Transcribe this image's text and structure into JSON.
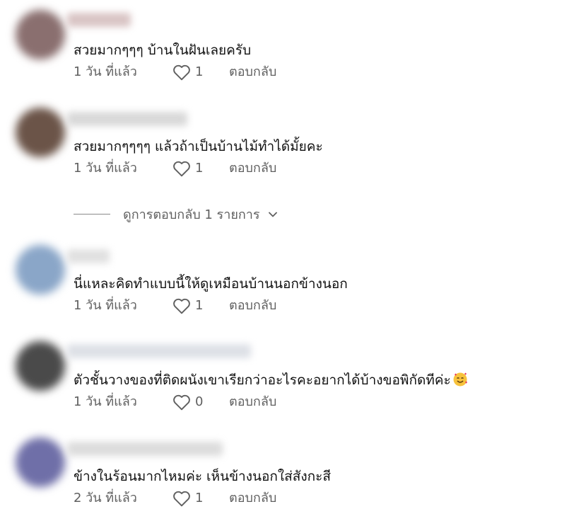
{
  "comments": [
    {
      "text": "สวยมากๆๆๆ บ้านในฝันเลยครับ",
      "time": "1 วัน ที่แล้ว",
      "likes": "1",
      "reply": "ตอบกลับ",
      "avatar_color": "#8a6f6f"
    },
    {
      "text": "สวยมากๆๆๆๆ แล้วถ้าเป็นบ้านไม้ทำได้มั้ยคะ",
      "time": "1 วัน ที่แล้ว",
      "likes": "1",
      "reply": "ตอบกลับ",
      "avatar_color": "#6b5448"
    },
    {
      "text": "นี่แหละคิดทำแบบนี้ให้ดูเหมือนบ้านนอกข้างนอก",
      "time": "1 วัน ที่แล้ว",
      "likes": "1",
      "reply": "ตอบกลับ",
      "avatar_color": "#8aa6c8"
    },
    {
      "text": "ตัวชั้นวางของที่ติดผนังเขาเรียกว่าอะไรคะอยากได้บ้างขอพิกัดทีค่ะ",
      "time": "1 วัน ที่แล้ว",
      "likes": "0",
      "reply": "ตอบกลับ",
      "avatar_color": "#4a4a4a"
    },
    {
      "text": "ข้างในร้อนมากไหมค่ะ เห็นข้างนอกใส่สังกะสี",
      "time": "2 วัน ที่แล้ว",
      "likes": "1",
      "reply": "ตอบกลับ",
      "avatar_color": "#6f6fa8"
    }
  ],
  "view_replies": {
    "label": "ดูการตอบกลับ 1 รายการ"
  }
}
